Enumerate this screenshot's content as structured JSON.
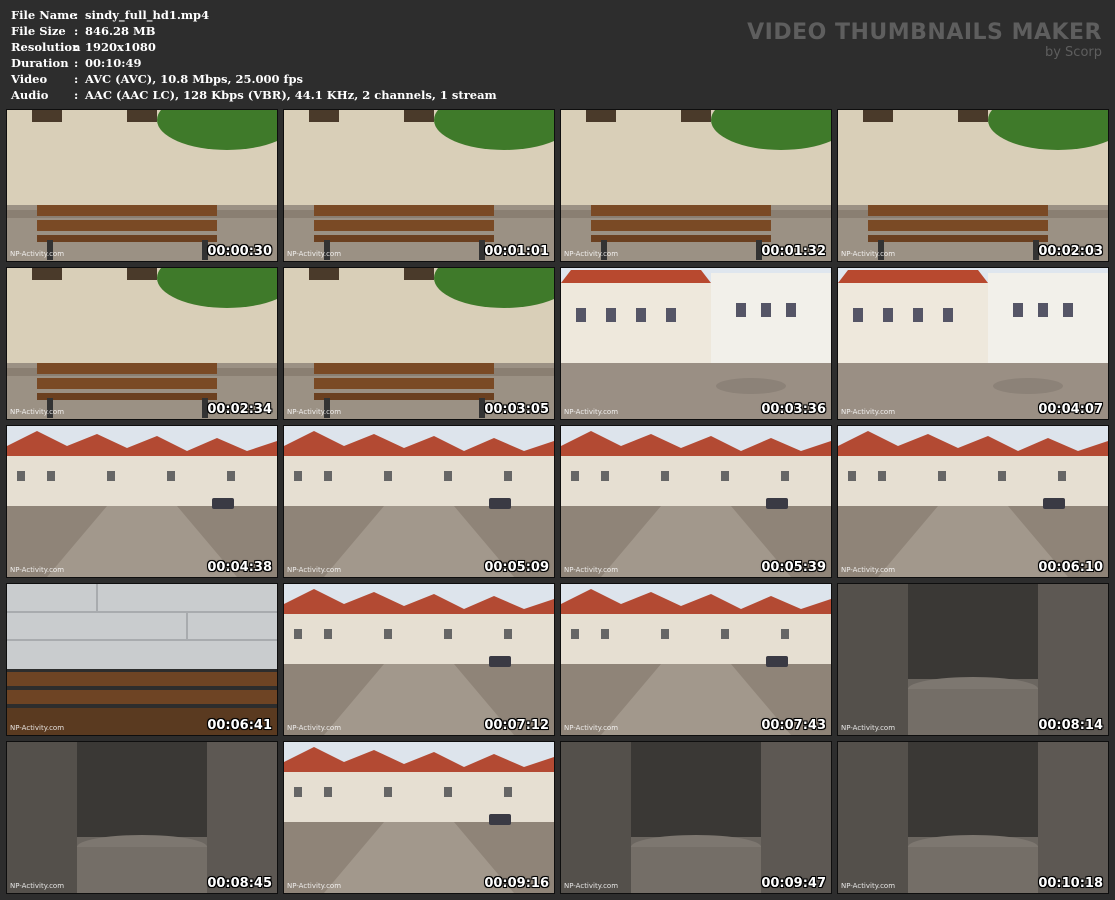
{
  "info": [
    {
      "key": "File Name",
      "value": "sindy_full_hd1.mp4"
    },
    {
      "key": "File Size",
      "value": "846.28 MB"
    },
    {
      "key": "Resolution",
      "value": "1920x1080"
    },
    {
      "key": "Duration",
      "value": "00:10:49"
    },
    {
      "key": "Video",
      "value": "AVC (AVC), 10.8 Mbps, 25.000 fps"
    },
    {
      "key": "Audio",
      "value": "AAC (AAC LC), 128 Kbps (VBR), 44.1 KHz, 2 channels, 1 stream"
    }
  ],
  "separator": ":",
  "brand": {
    "title": "VIDEO THUMBNAILS MAKER",
    "subtitle": "by Scorp"
  },
  "watermark": "NP-Activity.com",
  "thumbnails": [
    {
      "time": "00:00:30",
      "scene": "bench"
    },
    {
      "time": "00:01:01",
      "scene": "bench"
    },
    {
      "time": "00:01:32",
      "scene": "bench"
    },
    {
      "time": "00:02:03",
      "scene": "bench"
    },
    {
      "time": "00:02:34",
      "scene": "bench"
    },
    {
      "time": "00:03:05",
      "scene": "bench"
    },
    {
      "time": "00:03:36",
      "scene": "square"
    },
    {
      "time": "00:04:07",
      "scene": "square"
    },
    {
      "time": "00:04:38",
      "scene": "street"
    },
    {
      "time": "00:05:09",
      "scene": "street"
    },
    {
      "time": "00:05:39",
      "scene": "street"
    },
    {
      "time": "00:06:10",
      "scene": "street"
    },
    {
      "time": "00:06:41",
      "scene": "wall"
    },
    {
      "time": "00:07:12",
      "scene": "street"
    },
    {
      "time": "00:07:43",
      "scene": "street"
    },
    {
      "time": "00:08:14",
      "scene": "stone"
    },
    {
      "time": "00:08:45",
      "scene": "stone"
    },
    {
      "time": "00:09:16",
      "scene": "street"
    },
    {
      "time": "00:09:47",
      "scene": "stone"
    },
    {
      "time": "00:10:18",
      "scene": "stone"
    }
  ],
  "palette": {
    "background": "#2d2d2d",
    "text": "#ffffff",
    "brand": "#5e5e5e"
  }
}
